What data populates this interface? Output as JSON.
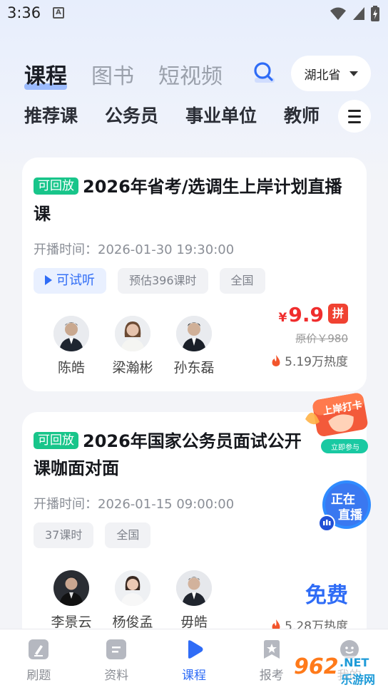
{
  "status_bar": {
    "time": "3:36",
    "notif_letter": "A"
  },
  "top_tabs": [
    {
      "label": "课程",
      "active": true
    },
    {
      "label": "图书",
      "active": false
    },
    {
      "label": "短视频",
      "active": false
    }
  ],
  "region": {
    "label": "湖北省"
  },
  "category_tabs": [
    "推荐课",
    "公务员",
    "事业单位",
    "教师"
  ],
  "courses": [
    {
      "badge": "可回放",
      "title": "2026年省考/选调生上岸计划直播课",
      "start_time": "开播时间：2026-01-30 19:30:00",
      "trial_label": "可试听",
      "tags": [
        "预估396课时",
        "全国"
      ],
      "teachers": [
        "陈皓",
        "梁瀚彬",
        "孙东磊"
      ],
      "price_symbol": "¥",
      "price": "9.9",
      "pin_label": "拼",
      "original_price": "原价￥980",
      "heat": "5.19万热度"
    },
    {
      "badge": "可回放",
      "title": "2026年国家公务员面试公开课咖面对面",
      "start_time": "开播时间：2026-01-15 09:00:00",
      "tags": [
        "37课时",
        "全国"
      ],
      "teachers": [
        "李景云",
        "杨俊孟",
        "毋皓"
      ],
      "price_label": "免费",
      "heat": "5.28万热度"
    }
  ],
  "floats": {
    "checkin_title": "上岸打卡",
    "checkin_sub": "立即参与",
    "live_line1": "正在",
    "live_line2": "直播"
  },
  "bottom_nav": [
    {
      "label": "刷题",
      "icon": "pen-icon",
      "active": false
    },
    {
      "label": "资料",
      "icon": "document-icon",
      "active": false
    },
    {
      "label": "课程",
      "icon": "play-icon",
      "active": true
    },
    {
      "label": "报考",
      "icon": "bookmark-star-icon",
      "active": false
    },
    {
      "label": "我的",
      "icon": "profile-icon",
      "active": false
    }
  ],
  "watermark": {
    "number": "962",
    "suffix": ".NET",
    "text": "乐游网"
  },
  "colors": {
    "accent": "#2f6cf6",
    "price_red": "#f02d2d",
    "replay_green": "#18c58a"
  }
}
